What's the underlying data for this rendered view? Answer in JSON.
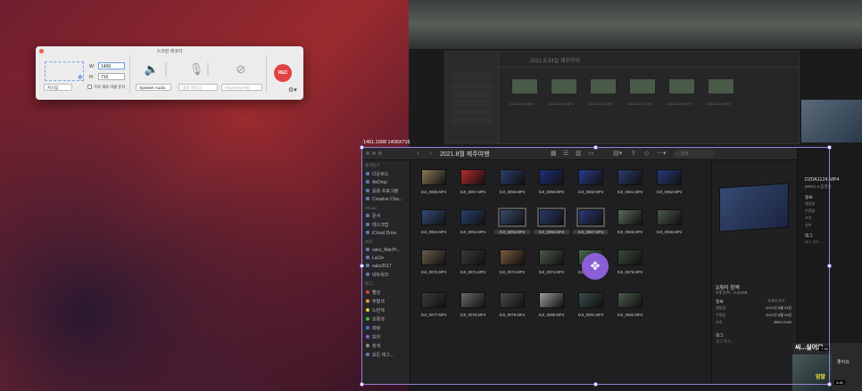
{
  "panel": {
    "title": "스크린 레코더",
    "w_label": "W:",
    "w_value": "1406",
    "h_label": "H:",
    "h_value": "716",
    "preset": "커스텀",
    "keep_ratio": "가로 세로 비율 유지",
    "speaker": "Speaker Audio",
    "mic": "내장 마이크",
    "camera": "FaceTime HD",
    "rec": "REC"
  },
  "selection": {
    "dims": "1461.1008 1406X716"
  },
  "finder": {
    "title": "2021.8월 제주여행",
    "search": "검색",
    "sidebar": [
      {
        "type": "head",
        "label": "즐겨찾기"
      },
      {
        "type": "item",
        "label": "다운로드"
      },
      {
        "type": "item",
        "label": "AirDrop"
      },
      {
        "type": "item",
        "label": "응용 프로그램"
      },
      {
        "type": "item",
        "label": "Creative Clou..."
      },
      {
        "type": "head",
        "label": "iCloud"
      },
      {
        "type": "item",
        "label": "문서"
      },
      {
        "type": "item",
        "label": "데스크탑"
      },
      {
        "type": "item",
        "label": "iCloud Drive"
      },
      {
        "type": "head",
        "label": "위치"
      },
      {
        "type": "item",
        "label": "sako_MacPr..."
      },
      {
        "type": "item",
        "label": "LaCie"
      },
      {
        "type": "item",
        "label": "sako2017"
      },
      {
        "type": "item",
        "label": "네트워크"
      },
      {
        "type": "head",
        "label": "태그"
      },
      {
        "type": "tag",
        "label": "빨강",
        "color": "#e0443e"
      },
      {
        "type": "tag",
        "label": "주황색",
        "color": "#f09a37"
      },
      {
        "type": "tag",
        "label": "노란색",
        "color": "#e8c93a"
      },
      {
        "type": "tag",
        "label": "초록색",
        "color": "#4fb34a"
      },
      {
        "type": "tag",
        "label": "파랑",
        "color": "#3a7be0"
      },
      {
        "type": "tag",
        "label": "보라",
        "color": "#9d5fd0"
      },
      {
        "type": "tag",
        "label": "회색",
        "color": "#8e8e93"
      },
      {
        "type": "item",
        "label": "모든 태그..."
      }
    ],
    "files": [
      {
        "name": "DJI_0056.MP4",
        "color": "#8a7a5a"
      },
      {
        "name": "DJI_0057.MP4",
        "color": "#b82a2a"
      },
      {
        "name": "DJI_0058.MP4",
        "color": "#2a3f6e"
      },
      {
        "name": "DJI_0059.MP4",
        "color": "#1f2f7a"
      },
      {
        "name": "DJI_0060.MP4",
        "color": "#2a3a8a"
      },
      {
        "name": "DJI_0061.MP4",
        "color": "#2a3f6e"
      },
      {
        "name": "DJI_0062.MP4",
        "color": "#2a3a7a"
      },
      {
        "name": "DJI_0063.MP4",
        "color": "#344a7a"
      },
      {
        "name": "DJI_0064.MP4",
        "color": "#2a3f6e"
      },
      {
        "name": "DJI_0065.MP4",
        "color": "#3a4a6e",
        "sel": true
      },
      {
        "name": "DJI_0066.MP4",
        "color": "#2a3a6e",
        "sel": true
      },
      {
        "name": "DJI_0067.MP4",
        "color": "#2a3a7a",
        "sel": true
      },
      {
        "name": "DJI_0068.MP4",
        "color": "#5a6a5a"
      },
      {
        "name": "DJI_0069.MP4",
        "color": "#4a5a4a"
      },
      {
        "name": "DJI_0070.MP4",
        "color": "#6a5a4a"
      },
      {
        "name": "DJI_0071.MP4",
        "color": "#3a3a3a"
      },
      {
        "name": "DJI_0073.MP4",
        "color": "#7a5a3a"
      },
      {
        "name": "DJI_0074.MP4",
        "color": "#4a5a4a"
      },
      {
        "name": "DJI_0075.MP4",
        "color": "#4a6a4a"
      },
      {
        "name": "DJI_0076.MP4",
        "color": "#3a4a3a"
      },
      {
        "name": "DJI_0077.MP4",
        "color": "#3a3a3a"
      },
      {
        "name": "DJI_0078.MP4",
        "color": "#6a6a6a"
      },
      {
        "name": "DJI_0079.MP4",
        "color": "#4a4a4a"
      },
      {
        "name": "DJI_0080.MP4",
        "color": "#9a9a9a"
      },
      {
        "name": "DJI_0081.MP4",
        "color": "#3a4a4a"
      },
      {
        "name": "DJI_0082.MP4",
        "color": "#4a5a4a"
      }
    ],
    "preview": {
      "count": "3개의 항목",
      "sub": "3개 문서 - 3.54GB",
      "info_head": "정보",
      "rows": [
        {
          "k": "생성일",
          "v": "2021년 8월 24일"
        },
        {
          "k": "수정일",
          "v": "2021년 8월 24일"
        },
        {
          "k": "크기",
          "v": "3840×2160"
        }
      ],
      "info_more": "자세히 보기",
      "tags_head": "태그",
      "tags_add": "태그 추가..."
    }
  },
  "right_panel": {
    "title": "D20A1124.MP4",
    "sub": "MPEG-4 동영상",
    "info": "정보",
    "rows": [
      "생성일",
      "수정일",
      "크기",
      "길이"
    ],
    "tags": "태그",
    "tags_add": "태그 추가...",
    "video_caption": "씨...실어요",
    "video_duration": "7:16",
    "video_badge": "맘말",
    "video_duration2": "4:45",
    "channel": "좋아요"
  },
  "background": {
    "window_title": "2021.8.24일 제주하이",
    "thumbs": [
      "D20A1106.MP4",
      "D20A1109.MP4",
      "D20A1112.MP4",
      "D20A1117.MP4",
      "D20A1122.MP4",
      "D20A1123.MP4"
    ]
  }
}
